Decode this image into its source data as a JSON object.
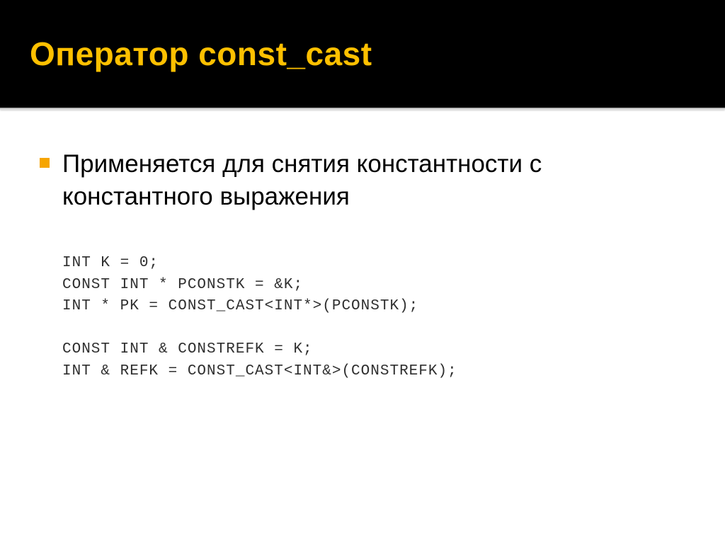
{
  "slide": {
    "title": "Оператор const_cast",
    "bullet1": "Применяется для снятия константности с константного выражения",
    "code": {
      "line1": "int k = 0;",
      "line2": "const int * pConstK = &k;",
      "line3": "int * pK = const_cast<int*>(pConstK);",
      "line4": "",
      "line5": "const int & constRefK = k;",
      "line6": "int & refK = const_cast<int&>(constRefK);"
    }
  }
}
